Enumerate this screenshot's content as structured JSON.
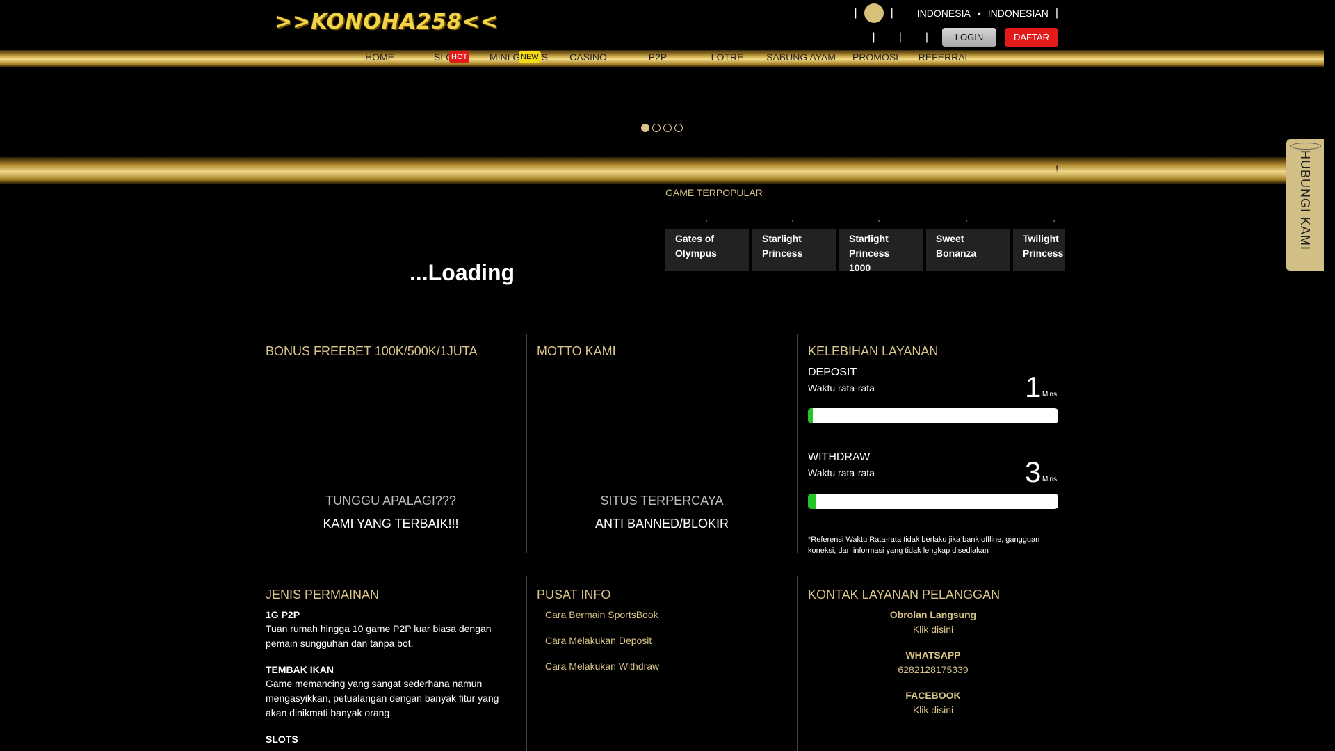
{
  "header": {
    "logo_text": ">>KONOHA258<<",
    "language_label": "INDONESIA",
    "language_name": "INDONESIAN",
    "login_label": "LOGIN",
    "register_label": "DAFTAR"
  },
  "nav": {
    "items": [
      {
        "label": "HOME"
      },
      {
        "label": "SLOTS",
        "badge": "HOT"
      },
      {
        "label": "MINI GAMES",
        "badge": "NEW"
      },
      {
        "label": "CASINO"
      },
      {
        "label": "P2P"
      },
      {
        "label": "LOTRE"
      },
      {
        "label": "SABUNG AYAM"
      },
      {
        "label": "PROMOSI"
      },
      {
        "label": "REFERRAL"
      }
    ]
  },
  "banner": {
    "slide_count": 4,
    "active_slide": 1
  },
  "marquee": {
    "text": "!"
  },
  "loading_text": "...Loading",
  "popular": {
    "title": "GAME TERPOPULAR",
    "games": [
      {
        "name_line1": "Gates of",
        "name_line2": "Olympus",
        "name_line3": ""
      },
      {
        "name_line1": "Starlight",
        "name_line2": "Princess",
        "name_line3": ""
      },
      {
        "name_line1": "Starlight",
        "name_line2": "Princess",
        "name_line3": "1000"
      },
      {
        "name_line1": "Sweet",
        "name_line2": "Bonanza",
        "name_line3": ""
      },
      {
        "name_line1": "Twilight",
        "name_line2": "Princess",
        "name_line3": ""
      }
    ]
  },
  "side_contact": {
    "label": "HUBUNGI KAMI"
  },
  "bonus": {
    "title": "BONUS FREEBET 100K/500K/1JUTA",
    "line1": "TUNGGU APALAGI???",
    "line2": "KAMI YANG TERBAIK!!!"
  },
  "motto": {
    "title": "MOTTO KAMI",
    "line1": "SITUS TERPERCAYA",
    "line2": "ANTI BANNED/BLOKIR"
  },
  "service": {
    "title": "KELEBIHAN LAYANAN",
    "deposit": {
      "label": "DEPOSIT",
      "sub": "Waktu rata-rata",
      "value": "1",
      "unit": "Mins",
      "fill": 0.02
    },
    "withdraw": {
      "label": "WITHDRAW",
      "sub": "Waktu rata-rata",
      "value": "3",
      "unit": "Mins",
      "fill": 0.03
    },
    "note": "*Referensi Waktu Rata-rata tidak berlaku jika bank offline, gangguan koneksi, dan informasi yang tidak lengkap disediakan"
  },
  "games_types": {
    "title": "JENIS PERMAINAN",
    "items": [
      {
        "name": "1G P2P",
        "desc": "Tuan rumah hingga 10 game P2P luar biasa dengan pemain sungguhan dan tanpa bot."
      },
      {
        "name": "TEMBAK IKAN",
        "desc": "Game memancing yang sangat sederhana namun mengasyikkan, petualangan dengan banyak fitur yang akan dinikmati banyak orang."
      },
      {
        "name": "SLOTS",
        "desc": ""
      }
    ]
  },
  "info": {
    "title": "PUSAT INFO",
    "links": [
      "Cara Bermain SportsBook",
      "Cara Melakukan Deposit",
      "Cara Melakukan Withdraw"
    ]
  },
  "contact": {
    "title": "KONTAK LAYANAN PELANGGAN",
    "live_chat_head": "Obrolan Langsung",
    "live_chat_val": "Klik disini",
    "whatsapp_head": "WHATSAPP",
    "whatsapp_val": "6282128175339",
    "facebook_head": "FACEBOOK",
    "facebook_val": "Klik disini"
  }
}
